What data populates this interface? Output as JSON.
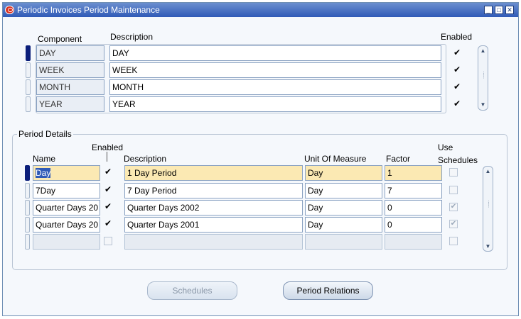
{
  "window": {
    "title": "Periodic Invoices Period Maintenance",
    "buttons": [
      "_",
      "□",
      "✕"
    ]
  },
  "components": {
    "headers": {
      "component": "Component",
      "description": "Description",
      "enabled": "Enabled"
    },
    "rows": [
      {
        "component": "DAY",
        "description": "DAY",
        "enabled": true,
        "check": "✔"
      },
      {
        "component": "WEEK",
        "description": "WEEK",
        "enabled": true,
        "check": "✔"
      },
      {
        "component": "MONTH",
        "description": "MONTH",
        "enabled": true,
        "check": "✔"
      },
      {
        "component": "YEAR",
        "description": "YEAR",
        "enabled": true,
        "check": "✔"
      }
    ]
  },
  "period_details": {
    "title": "Period Details",
    "headers": {
      "name": "Name",
      "enabled": "Enabled",
      "description": "Description",
      "uom": "Unit Of Measure",
      "factor": "Factor",
      "use_schedules_1": "Use",
      "use_schedules_2": "Schedules"
    },
    "rows": [
      {
        "name": "Day",
        "enabled": true,
        "check": "✔",
        "description": "1 Day Period",
        "uom": "Day",
        "factor": "1",
        "use_schedules": false
      },
      {
        "name": "7Day",
        "enabled": true,
        "check": "✔",
        "description": "7 Day Period",
        "uom": "Day",
        "factor": "7",
        "use_schedules": false
      },
      {
        "name": "Quarter Days 20",
        "enabled": true,
        "check": "✔",
        "description": "Quarter Days 2002",
        "uom": "Day",
        "factor": "0",
        "use_schedules": true,
        "use_check": "✔"
      },
      {
        "name": "Quarter Days 20",
        "enabled": true,
        "check": "✔",
        "description": "Quarter Days 2001",
        "uom": "Day",
        "factor": "0",
        "use_schedules": true,
        "use_check": "✔"
      },
      {
        "name": "",
        "enabled": false,
        "description": "",
        "uom": "",
        "factor": "",
        "use_schedules": false
      }
    ]
  },
  "buttons": {
    "schedules": "Schedules",
    "period_relations": "Period Relations"
  },
  "colors": {
    "title_bar": "#2f5ab7",
    "selected_row": "#fbe9b3",
    "record_indicator": "#0b1e7a"
  }
}
